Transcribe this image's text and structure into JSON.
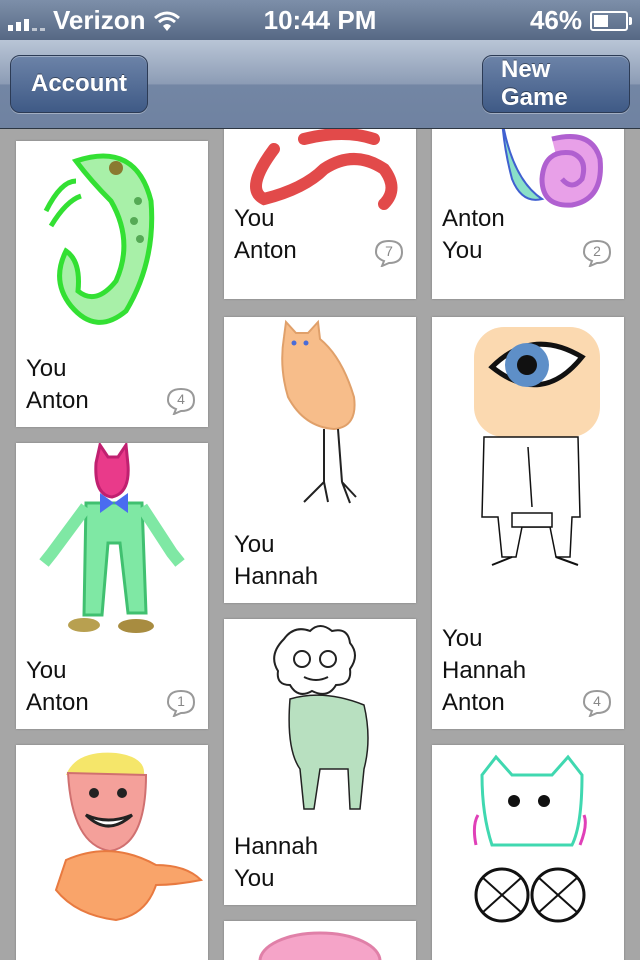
{
  "status": {
    "carrier": "Verizon",
    "time": "10:44 PM",
    "battery": "46%",
    "battery_level": 0.46
  },
  "nav": {
    "left_button": "Account",
    "right_button": "New Game"
  },
  "cards": [
    {
      "names": [
        "You",
        "Anton"
      ],
      "comments": "4"
    },
    {
      "names": [
        "You",
        "Anton"
      ],
      "comments": "1"
    },
    {
      "names": [],
      "comments": null
    },
    {
      "names": [
        "You",
        "Anton"
      ],
      "comments": "7"
    },
    {
      "names": [
        "You",
        "Hannah"
      ],
      "comments": null
    },
    {
      "names": [
        "Hannah",
        "You"
      ],
      "comments": null
    },
    {
      "names": [],
      "comments": null
    },
    {
      "names": [
        "Anton",
        "You"
      ],
      "comments": "2"
    },
    {
      "names": [
        "You",
        "Hannah",
        "Anton"
      ],
      "comments": "4"
    },
    {
      "names": [],
      "comments": null
    }
  ]
}
